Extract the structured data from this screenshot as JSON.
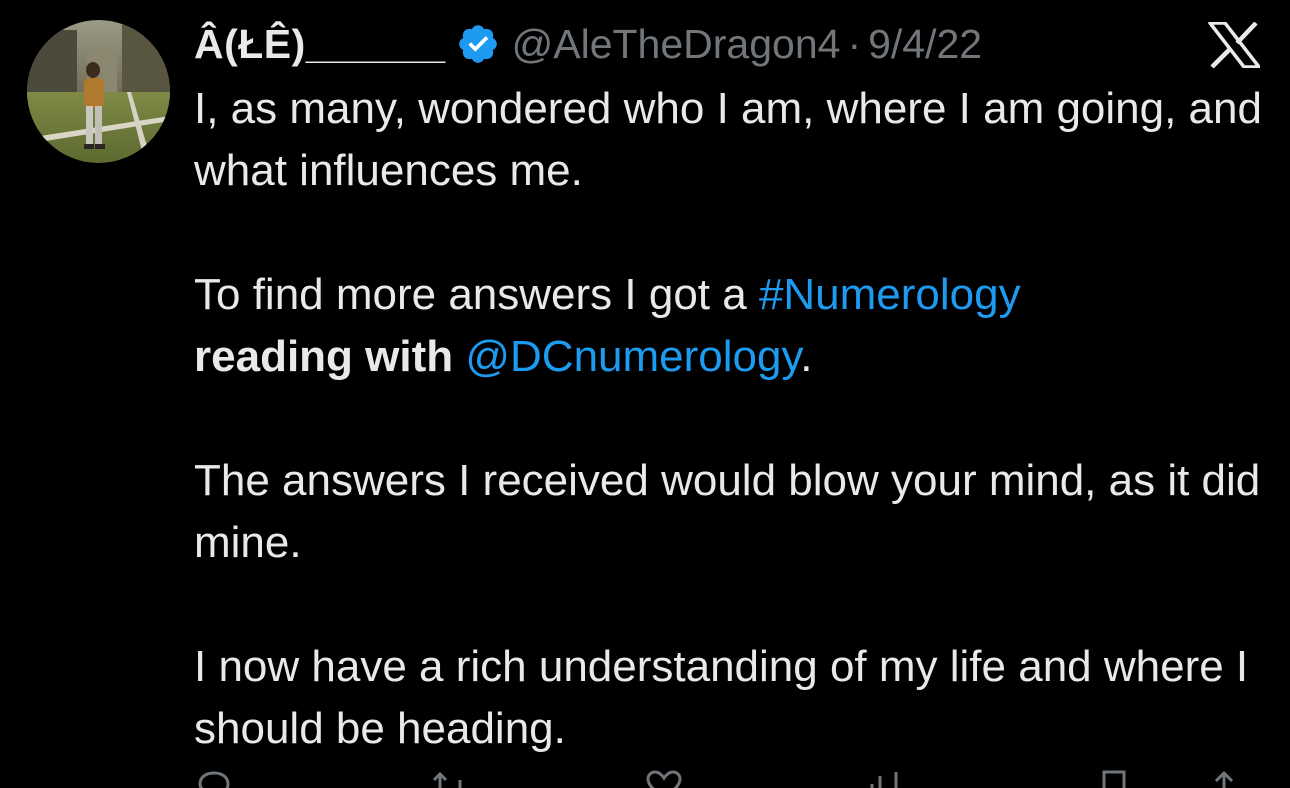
{
  "author": {
    "display_name": "Â(ŁÊ)______",
    "handle": "@AleTheDragon4",
    "separator": "·",
    "date": "9/4/22",
    "verified": true
  },
  "tweet": {
    "line1": "I, as many,  wondered who I am, where I am going, and what influences me.",
    "para2_prefix": "To find more answers I got a ",
    "para2_hashtag": "#Numerology",
    "para2_bold": "reading with",
    "para2_mention": "@DCnumerology",
    "para2_suffix": ".",
    "para3": "The answers I received would blow your mind, as it did mine.",
    "para4": "I now have a rich understanding of my life and where I should be heading."
  },
  "icons": {
    "verified_badge": "verified-badge-icon",
    "platform_logo": "x-logo-icon",
    "actions": [
      "reply-icon",
      "retweet-icon",
      "like-icon",
      "views-icon",
      "bookmark-icon",
      "share-icon"
    ]
  },
  "colors": {
    "background": "#000000",
    "text": "#e7e9ea",
    "secondary": "#71767b",
    "link": "#1d9bf0"
  }
}
